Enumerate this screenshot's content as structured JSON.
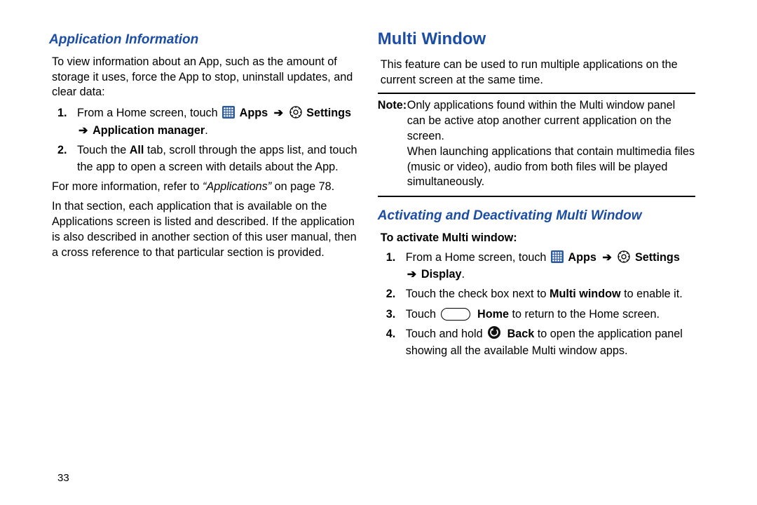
{
  "left": {
    "h1": "Application Information",
    "intro": "To view information about an App, such as the amount of storage it uses, force the App to stop, uninstall updates, and clear data:",
    "step1": {
      "lead": "From a Home screen, touch ",
      "apps": "Apps",
      "arrow1": "➔",
      "settings": "Settings",
      "arrow2": "➔",
      "appmgr": "Application manager",
      "period": "."
    },
    "step2a": "Touch the ",
    "step2_bold": "All",
    "step2b": " tab, scroll through the apps list, and touch the app to open a screen with details about the App.",
    "more1a": "For more information, refer to ",
    "more1b": "“Applications”",
    "more1c": " on page 78.",
    "more2": "In that section, each application that is available on the Applications screen is listed and described. If the application is also described in another section of this user manual, then a cross reference to that particular section is provided."
  },
  "right": {
    "h1": "Multi Window",
    "intro": "This feature can be used to run multiple applications on the current screen at the same time.",
    "note_lead": "Note:",
    "note_body1": "Only applications found within the Multi window panel can be active atop another current application on the screen.",
    "note_body2": "When launching applications that contain multimedia files (music or video), audio from both files will be played simultaneously.",
    "h2": "Activating and Deactivating Multi Window",
    "subhead": "To activate Multi window:",
    "step1": {
      "lead": "From a Home screen, touch ",
      "apps": "Apps",
      "arrow1": "➔",
      "settings": "Settings",
      "arrow2": "➔",
      "display": "Display",
      "period": "."
    },
    "step2a": "Touch the check box next to ",
    "step2b": "Multi window",
    "step2c": " to enable it.",
    "step3a": "Touch ",
    "step3b": "Home",
    "step3c": " to return to the Home screen.",
    "step4a": "Touch and hold ",
    "step4b": "Back",
    "step4c": " to open the application panel showing all the available Multi window apps."
  },
  "page_number": "33"
}
